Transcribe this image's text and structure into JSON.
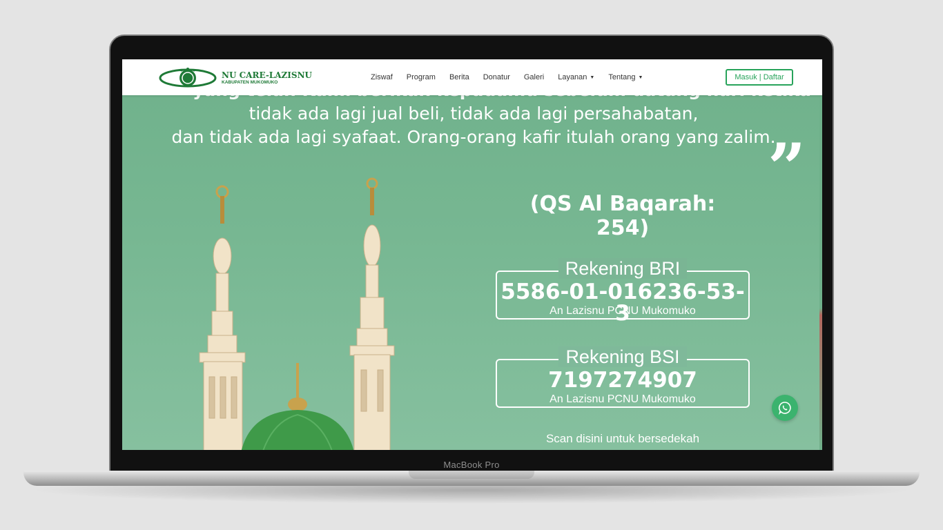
{
  "device": {
    "brand_label": "MacBook Pro"
  },
  "header": {
    "logo": {
      "title": "NU CARE-LAZISNU",
      "subtitle": "KABUPATEN MUKOMUKO"
    },
    "nav": [
      {
        "label": "Ziswaf"
      },
      {
        "label": "Program"
      },
      {
        "label": "Berita"
      },
      {
        "label": "Donatur"
      },
      {
        "label": "Galeri"
      },
      {
        "label": "Layanan",
        "dropdown": true
      },
      {
        "label": "Tentang",
        "dropdown": true
      }
    ],
    "login_label": "Masuk | Daftar"
  },
  "hero": {
    "quote_lines": [
      "yang telah Kami berikan kepadamu sebelum datang hari ketika",
      "tidak ada lagi jual beli, tidak ada lagi persahabatan,",
      "dan tidak ada lagi syafaat. Orang-orang kafir itulah orang yang zalim."
    ],
    "closing_quote": "”",
    "reference": "(QS Al Baqarah: 254)",
    "accounts": [
      {
        "title": "Rekening BRI",
        "number": "5586-01-016236-53-3",
        "holder": "An Lazisnu PCNU Mukomuko"
      },
      {
        "title": "Rekening BSI",
        "number": "7197274907",
        "holder": "An Lazisnu PCNU Mukomuko"
      }
    ],
    "scan_text": "Scan disini untuk bersedekah"
  },
  "floating": {
    "whatsapp_icon": "whatsapp-icon"
  },
  "colors": {
    "brand_green": "#27a35a",
    "hero_green": "#77b792",
    "whatsapp_green": "#3bb36e"
  }
}
